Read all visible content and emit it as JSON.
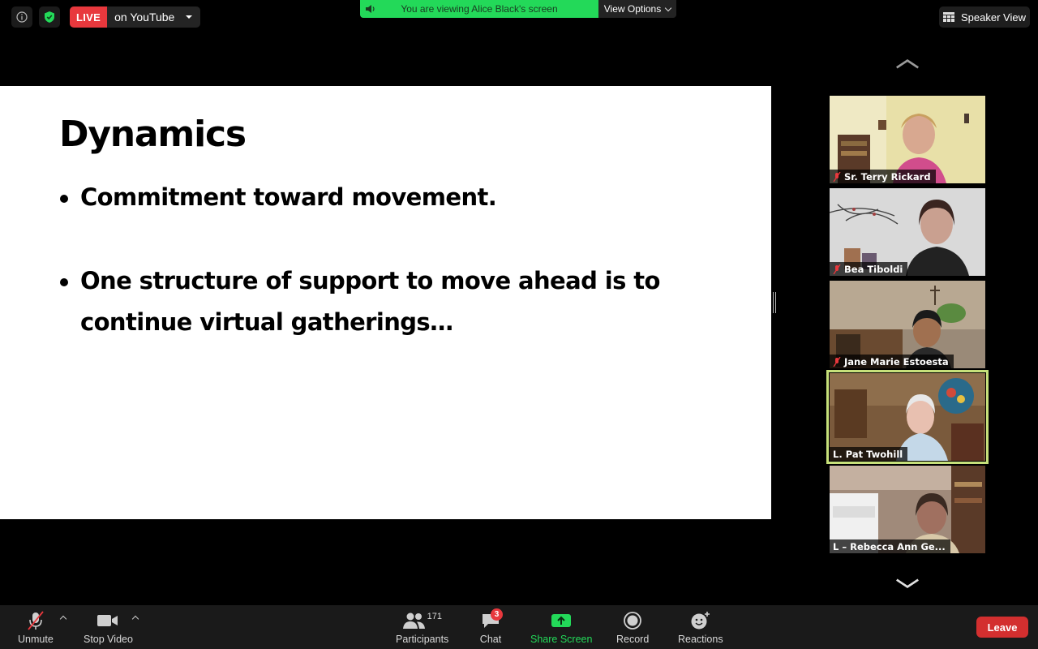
{
  "topbar": {
    "live_badge": "LIVE",
    "live_target": "on YouTube",
    "viewing_text": "You are viewing Alice Black's screen",
    "view_options": "View Options",
    "speaker_view": "Speaker View"
  },
  "slide": {
    "title": "Dynamics",
    "bullets": [
      "Commitment toward movement.",
      "One structure of support to move ahead is to continue virtual gatherings…"
    ]
  },
  "gallery": {
    "participants": [
      {
        "name": "Sr. Terry Rickard",
        "muted": true
      },
      {
        "name": "Bea Tiboldi",
        "muted": true
      },
      {
        "name": "Jane Marie Estoesta",
        "muted": true
      },
      {
        "name": "L. Pat Twohill",
        "muted": false,
        "active_speaker": true
      },
      {
        "name": "L – Rebecca Ann Ge...",
        "muted": false
      }
    ]
  },
  "toolbar": {
    "unmute": "Unmute",
    "stop_video": "Stop Video",
    "participants": "Participants",
    "participant_count": "171",
    "chat": "Chat",
    "chat_badge": "3",
    "share_screen": "Share Screen",
    "record": "Record",
    "reactions": "Reactions",
    "leave": "Leave"
  },
  "colors": {
    "live_red": "#e8383d",
    "share_green": "#23d959",
    "active_outline": "#c6e07a",
    "leave_red": "#d32f2f"
  }
}
